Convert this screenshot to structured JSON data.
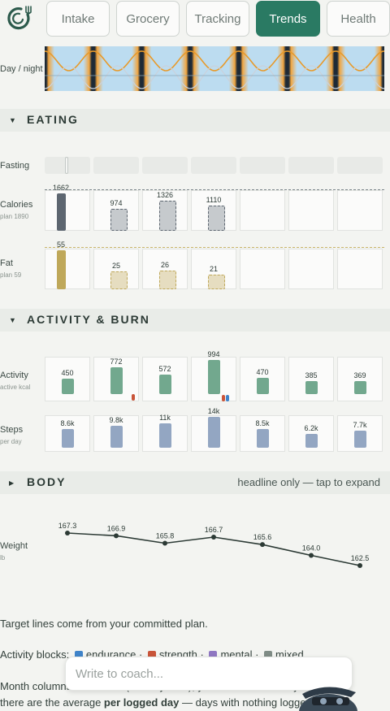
{
  "nav": {
    "tabs": [
      {
        "label": "Intake",
        "active": false
      },
      {
        "label": "Grocery",
        "active": false
      },
      {
        "label": "Tracking",
        "active": false
      },
      {
        "label": "Trends",
        "active": true
      },
      {
        "label": "Health",
        "active": false
      }
    ]
  },
  "daynight": {
    "label": "Day / night"
  },
  "eating": {
    "title": "EATING",
    "fasting_label": "Fasting",
    "calories": {
      "label": "Calories",
      "plan": "plan 1890",
      "values": [
        1662,
        974,
        1326,
        1110
      ],
      "color": "#5d6670",
      "ghost": "#c6cacd"
    },
    "fat": {
      "label": "Fat",
      "plan": "plan 59",
      "values": [
        55,
        25,
        26,
        21
      ],
      "color": "#bfa85a",
      "ghost": "#e6ddc0"
    }
  },
  "activity": {
    "title": "ACTIVITY & BURN",
    "activity": {
      "label": "Activity",
      "sub": "active kcal",
      "values": [
        450,
        772,
        572,
        994,
        470,
        385,
        369
      ],
      "color": "#72a88e"
    },
    "steps": {
      "label": "Steps",
      "sub": "per day",
      "labels": [
        "8.6k",
        "9.8k",
        "11k",
        "14k",
        "8.5k",
        "6.2k",
        "7.7k"
      ],
      "values": [
        8.6,
        9.8,
        11,
        14,
        8.5,
        6.2,
        7.7
      ],
      "color": "#93a6c2"
    }
  },
  "body": {
    "title": "BODY",
    "hint": "headline only — tap to expand",
    "weight": {
      "label": "Weight",
      "unit": "lb",
      "values": [
        167.3,
        166.9,
        165.8,
        166.7,
        165.6,
        164.0,
        162.5
      ],
      "labels": [
        "167.3",
        "166.9",
        "165.8",
        "166.7",
        "165.6",
        "164.0",
        "162.5"
      ]
    }
  },
  "footnotes": {
    "line1": "Target lines come from your committed plan.",
    "blocks_prefix": "Activity blocks:",
    "blocks": [
      {
        "name": "endurance",
        "color": "#3f83c9"
      },
      {
        "name": "strength",
        "color": "#c9553a"
      },
      {
        "name": "mental",
        "color": "#8f77c2"
      },
      {
        "name": "mixed",
        "color": "#7f8c86"
      }
    ],
    "line3": "Month columns are weeks (Sunday start); your columns are days. Bars",
    "line4_a": "there are the average ",
    "line4_b": "per logged day",
    "line4_c": " — days with nothing logged are left"
  },
  "coach": {
    "placeholder": "Write to coach..."
  }
}
